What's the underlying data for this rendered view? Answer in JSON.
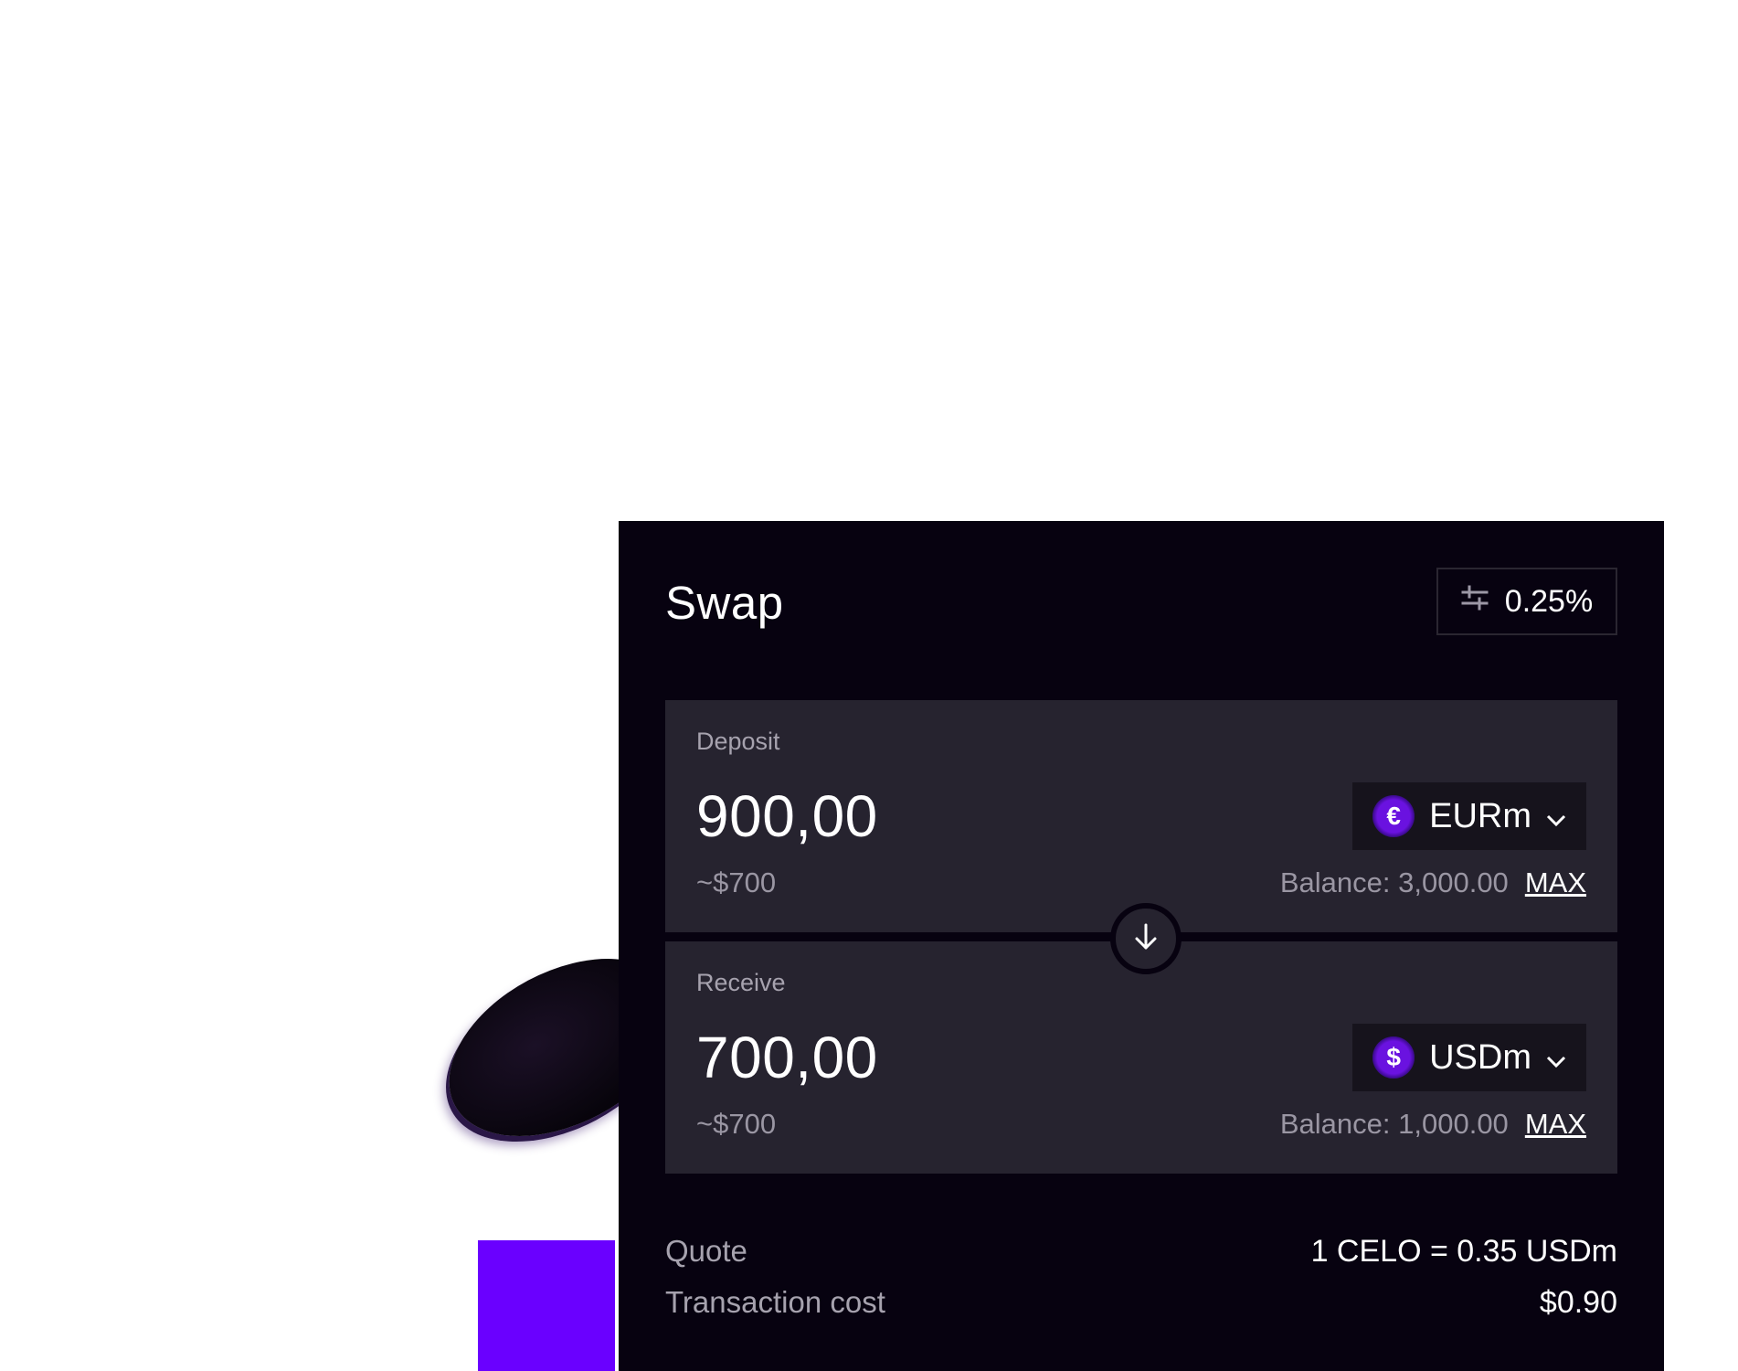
{
  "swap": {
    "title": "Swap",
    "slippage": "0.25%",
    "deposit": {
      "label": "Deposit",
      "amount": "900,00",
      "usd_value": "~$700",
      "token": "EURm",
      "token_symbol": "€",
      "balance": "Balance: 3,000.00",
      "max_label": "MAX"
    },
    "receive": {
      "label": "Receive",
      "amount": "700,00",
      "usd_value": "~$700",
      "token": "USDm",
      "token_symbol": "$",
      "balance": "Balance: 1,000.00",
      "max_label": "MAX"
    },
    "quote_label": "Quote",
    "quote_value": "1 CELO = 0.35 USDm",
    "tx_cost_label": "Transaction cost",
    "tx_cost_value": "$0.90"
  },
  "colors": {
    "card_bg": "#070210",
    "panel_bg": "#26232f",
    "accent_purple": "#6a00ff"
  }
}
